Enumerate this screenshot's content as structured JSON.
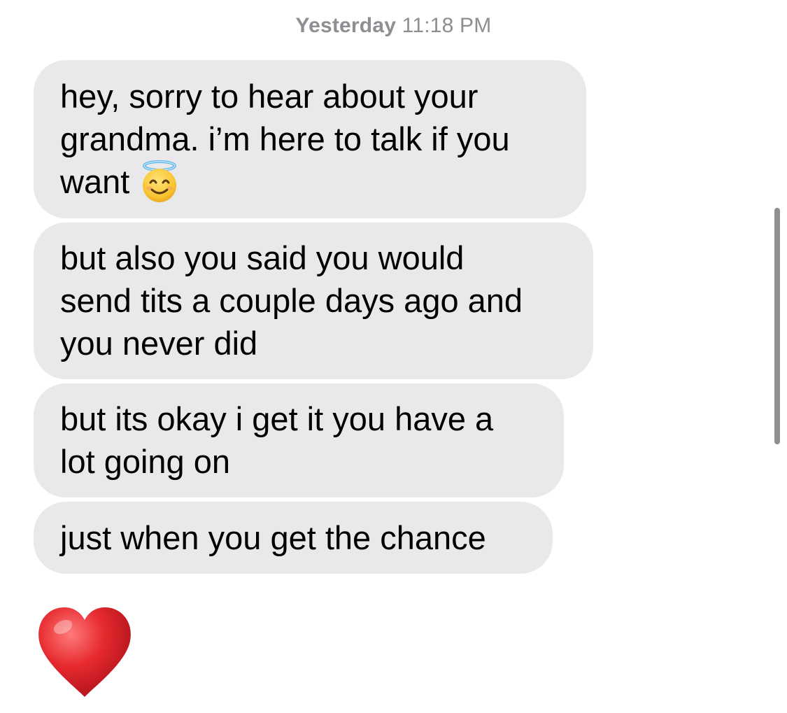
{
  "header": {
    "timestamp_day": "Yesterday",
    "timestamp_time": "11:18 PM"
  },
  "messages": [
    {
      "lines": [
        "hey, sorry to hear about your",
        "grandma. i’m here to talk if you",
        "want"
      ],
      "emoji": "smiling-face-with-halo"
    },
    {
      "lines": [
        "but also you said you would",
        "send tits a couple days ago and",
        "you never did"
      ]
    },
    {
      "lines": [
        "but its okay i get it you have a",
        "lot going on"
      ]
    },
    {
      "lines": [
        "just when you get the chance"
      ]
    },
    {
      "emoji": "red-heart"
    }
  ],
  "colors": {
    "bubble": "#e9e9eb",
    "text": "#000000",
    "timestamp": "#8e8e93",
    "heart": "#e0262c"
  }
}
